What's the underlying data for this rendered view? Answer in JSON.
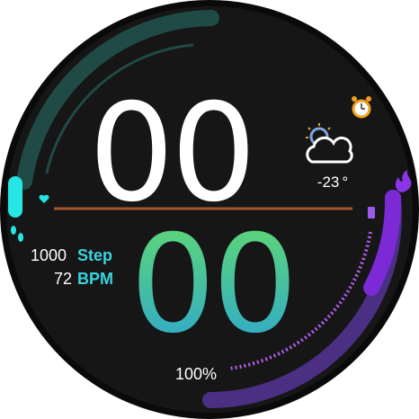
{
  "watch": {
    "time": {
      "hours": "00",
      "minutes": "00"
    },
    "steps": {
      "value": "1000",
      "unit": "Step",
      "progress": 0.55
    },
    "heart_rate": {
      "value": "72",
      "unit": "BPM"
    },
    "weather": {
      "temperature": "-23",
      "unit": "°",
      "icon": "partly-cloudy-icon"
    },
    "battery": {
      "percent": "100%",
      "progress": 1.0
    },
    "calories": {
      "icon": "flame-icon",
      "progress": 0.6
    },
    "alarm": {
      "icon": "alarm-clock-icon"
    },
    "colors": {
      "background": "#161616",
      "bezel": "#000000",
      "steps_arc": "#1f4a45",
      "steps_accent": "#25e6e4",
      "minutes_gradient_top": "#63dc6c",
      "minutes_gradient_bottom": "#2aa3d6",
      "divider": "#a8562e",
      "battery_arc": "#7b2ad6",
      "battery_arc_dark": "#4b2f82",
      "label_accent": "#39d3e0"
    }
  }
}
